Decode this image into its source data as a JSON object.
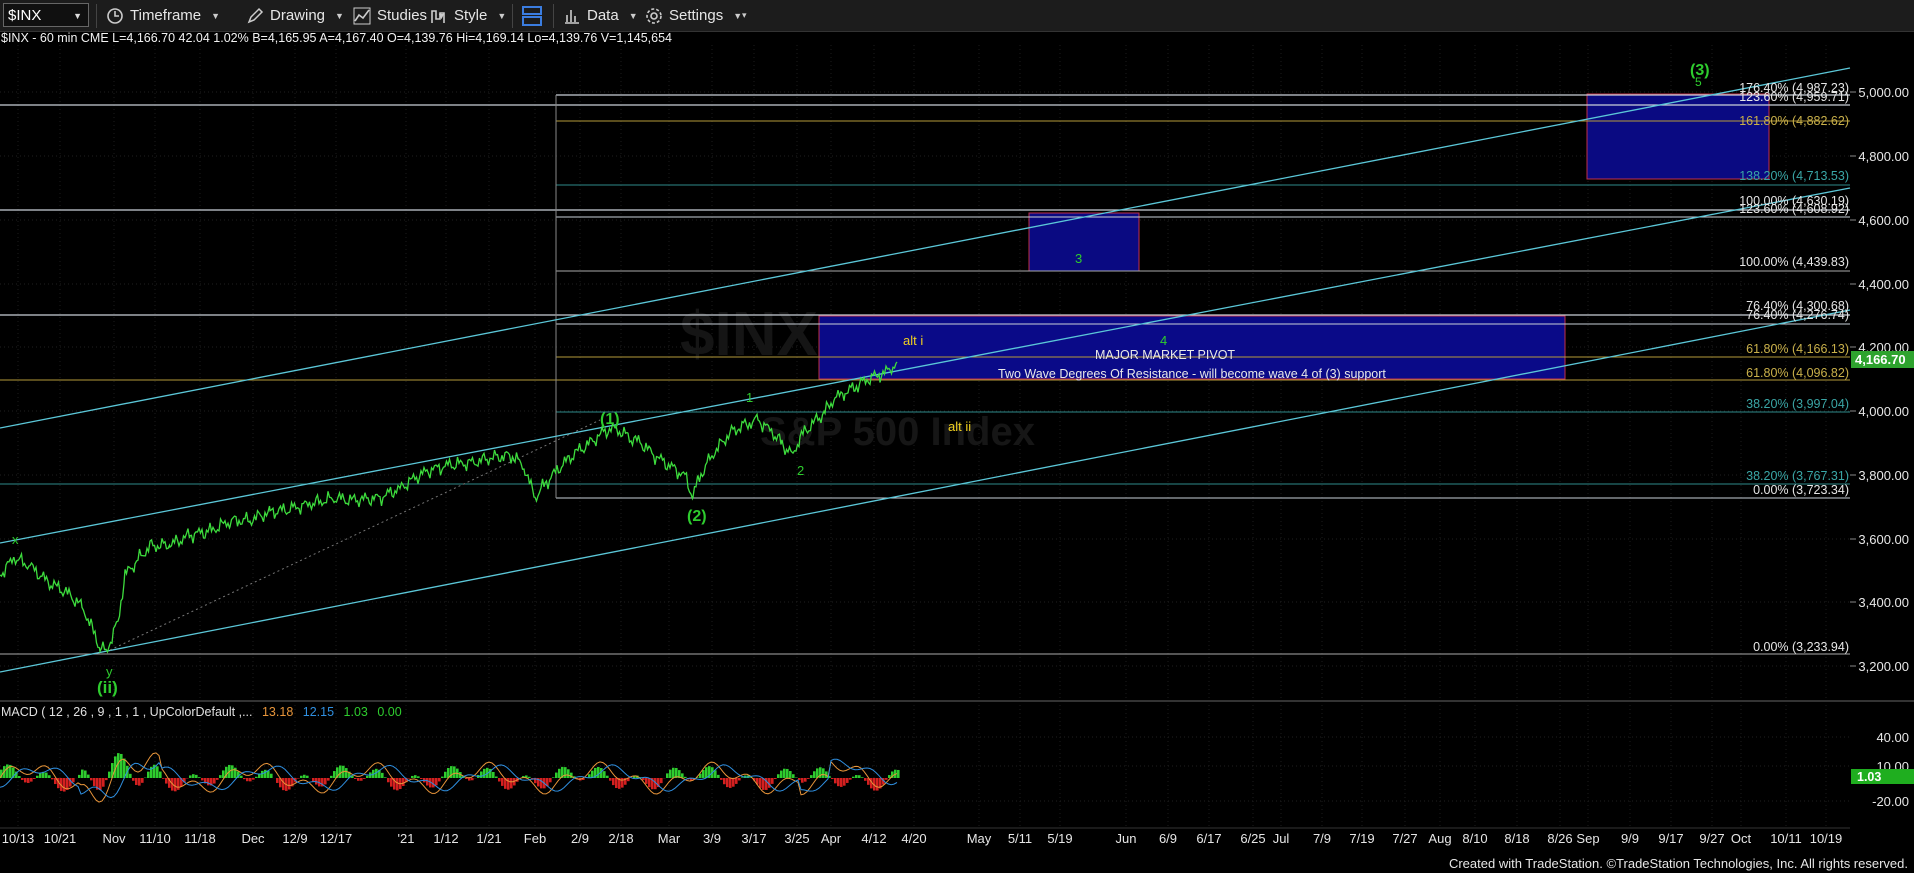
{
  "toolbar": {
    "symbol": "$INX",
    "timeframe": "Timeframe",
    "drawing": "Drawing",
    "studies": "Studies",
    "style": "Style",
    "data": "Data",
    "settings": "Settings"
  },
  "quote": "$INX - 60 min  CME  L=4,166.70  42.04  1.02%  B=4,165.95  A=4,167.40  O=4,139.76  Hi=4,169.14  Lo=4,139.76  V=1,145,654",
  "watermark": {
    "symbol": "$INX",
    "name": "S&P 500 Index"
  },
  "price_axis": {
    "labels": [
      "5,000.00",
      "4,800.00",
      "4,600.00",
      "4,400.00",
      "4,200.00",
      "4,000.00",
      "3,800.00",
      "3,600.00",
      "3,400.00",
      "3,200.00"
    ],
    "last_price": "4,166.70",
    "last_price_color": "#2ea32e"
  },
  "macd_axis": {
    "labels": [
      "40.00",
      "10.00",
      "-20.00"
    ],
    "last": "1.03",
    "last_color": "#22bb22"
  },
  "macd_header": {
    "name": "MACD ( 12 , 26 , 9 , 1 , 1 , UpColorDefault ,...",
    "v1": "13.18",
    "v2": "12.15",
    "v3": "1.03",
    "v4": "0.00",
    "c1": "#e8953a",
    "c2": "#2f8fe0",
    "c3": "#2ecc2e",
    "c4": "#2ecc2e"
  },
  "time_axis": [
    "10/13",
    "10/21",
    "Nov",
    "11/10",
    "11/18",
    "Dec",
    "12/9",
    "12/17",
    "'21",
    "1/12",
    "1/21",
    "Feb",
    "2/9",
    "2/18",
    "Mar",
    "3/9",
    "3/17",
    "3/25",
    "Apr",
    "4/12",
    "4/20",
    "May",
    "5/11",
    "5/19",
    "Jun",
    "6/9",
    "6/17",
    "6/25",
    "Jul",
    "7/9",
    "7/19",
    "7/27",
    "Aug",
    "8/10",
    "8/18",
    "8/26",
    "Sep",
    "9/9",
    "9/17",
    "9/27",
    "Oct",
    "10/11",
    "10/19"
  ],
  "fib_labels": [
    {
      "text": "176.40% (4,987.23)",
      "color": "#e6e6e6"
    },
    {
      "text": "123.60% (4,959.71)",
      "color": "#e6e6e6"
    },
    {
      "text": "161.80% (4,882.62)",
      "color": "#c9b04a"
    },
    {
      "text": "138.20% (4,713.53)",
      "color": "#3aa6a6"
    },
    {
      "text": "100.00% (4,630.19)",
      "color": "#e6e6e6"
    },
    {
      "text": "123.60% (4,608.92)",
      "color": "#e6e6e6"
    },
    {
      "text": "100.00% (4,439.83)",
      "color": "#e6e6e6"
    },
    {
      "text": "76.40% (4,300.68)",
      "color": "#e6e6e6"
    },
    {
      "text": "76.40% (4,276.74)",
      "color": "#e6e6e6"
    },
    {
      "text": "61.80% (4,166.13)",
      "color": "#c9b04a"
    },
    {
      "text": "61.80% (4,096.82)",
      "color": "#c9b04a"
    },
    {
      "text": "38.20% (3,997.04)",
      "color": "#3aa6a6"
    },
    {
      "text": "38.20% (3,767.31)",
      "color": "#3aa6a6"
    },
    {
      "text": "0.00% (3,723.34)",
      "color": "#e6e6e6"
    },
    {
      "text": "0.00% (3,233.94)",
      "color": "#e6e6e6"
    }
  ],
  "annotations": {
    "pivot_title": "MAJOR MARKET PIVOT",
    "pivot_sub": "Two Wave Degrees Of Resistance - will become wave 4 of (3) support",
    "alt_i": "alt i",
    "alt_ii": "alt ii",
    "w3_target": "3",
    "w4": "4",
    "w5": "5",
    "w3_big": "(3)",
    "w1_big": "(1)",
    "w2_big": "(2)",
    "w1_small": "1",
    "w2_small": "2",
    "x": "x",
    "y": "y",
    "ii": "(ii)"
  },
  "footer": "Created with TradeStation. ©TradeStation Technologies, Inc. All rights reserved."
}
